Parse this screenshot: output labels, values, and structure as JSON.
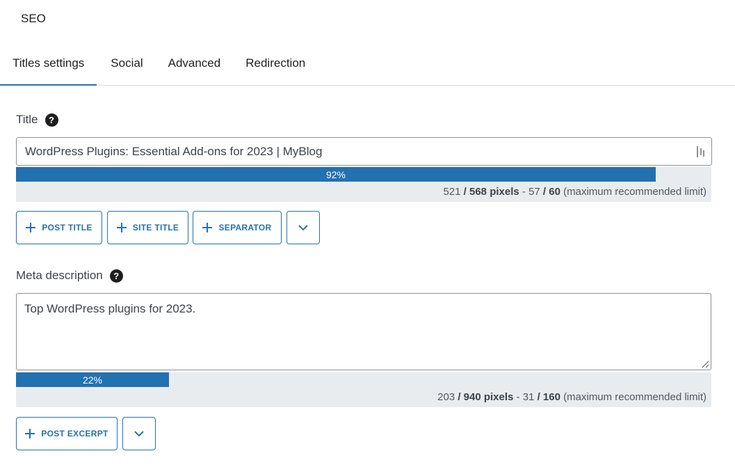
{
  "panel": {
    "title": "SEO"
  },
  "tabs": [
    {
      "label": "Titles settings",
      "active": true
    },
    {
      "label": "Social"
    },
    {
      "label": "Advanced"
    },
    {
      "label": "Redirection"
    }
  ],
  "title_field": {
    "label": "Title",
    "value": "WordPress Plugins: Essential Add-ons for 2023 | MyBlog",
    "meter": {
      "percent_label": "92%",
      "fill_percent": 92,
      "pixels_used": "521",
      "pixels_max": "568 pixels",
      "chars_used": "57",
      "chars_max": "60",
      "note": "(maximum recommended limit)"
    },
    "buttons": [
      "POST TITLE",
      "SITE TITLE",
      "SEPARATOR"
    ]
  },
  "meta_field": {
    "label": "Meta description",
    "value": "Top WordPress plugins for 2023.",
    "meter": {
      "percent_label": "22%",
      "fill_percent": 22,
      "pixels_used": "203",
      "pixels_max": "940 pixels",
      "chars_used": "31",
      "chars_max": "160",
      "note": "(maximum recommended limit)"
    },
    "buttons": [
      "POST EXCERPT"
    ]
  },
  "icons": {
    "help": "help-circle-icon",
    "add": "plus-icon",
    "more": "chevron-down-icon",
    "input": "variable-tag-icon"
  },
  "colors": {
    "accent": "#2271b1",
    "meter_bg": "#e8ecef"
  }
}
